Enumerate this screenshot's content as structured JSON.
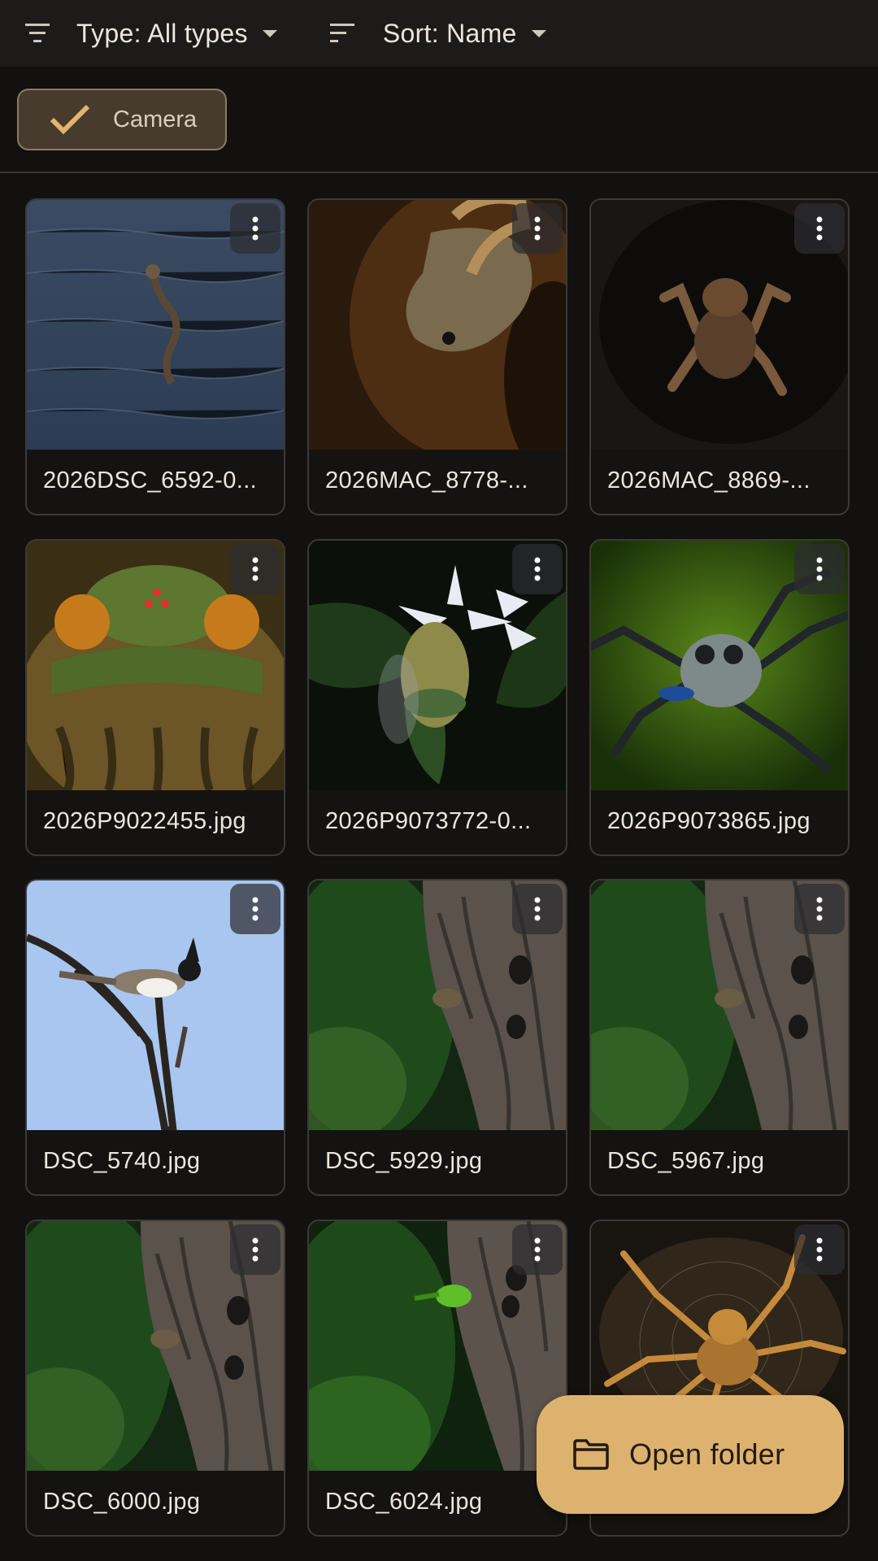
{
  "toolbar": {
    "filter_icon": "filter-list-icon",
    "type_label": "Type: All types",
    "sort_icon": "sort-icon",
    "sort_label": "Sort: Name"
  },
  "chips": [
    {
      "label": "Camera",
      "selected": true,
      "icon": "check-icon"
    }
  ],
  "files": [
    {
      "name": "2026DSC_6592-0...",
      "thumb": "bird-in-water"
    },
    {
      "name": "2026MAC_8778-...",
      "thumb": "gecko-on-bark"
    },
    {
      "name": "2026MAC_8869-...",
      "thumb": "spider-in-hole"
    },
    {
      "name": "2026P9022455.jpg",
      "thumb": "cicada-closeup"
    },
    {
      "name": "2026P9073772-0...",
      "thumb": "bee-on-flower"
    },
    {
      "name": "2026P9073865.jpg",
      "thumb": "jumping-spider"
    },
    {
      "name": "DSC_5740.jpg",
      "thumb": "bird-on-branch"
    },
    {
      "name": "DSC_5929.jpg",
      "thumb": "bird-on-tree-trunk"
    },
    {
      "name": "DSC_5967.jpg",
      "thumb": "bird-on-tree-trunk"
    },
    {
      "name": "DSC_6000.jpg",
      "thumb": "bird-on-tree-trunk"
    },
    {
      "name": "DSC_6024.jpg",
      "thumb": "green-bird-on-trunk"
    },
    {
      "name": "",
      "thumb": "orange-spider"
    }
  ],
  "menu_icon": "more-vert-icon",
  "fab": {
    "label": "Open folder",
    "icon": "folder-icon"
  },
  "colors": {
    "accent": "#ddb26f",
    "chip_bg": "#473b2d",
    "background": "#121110"
  }
}
